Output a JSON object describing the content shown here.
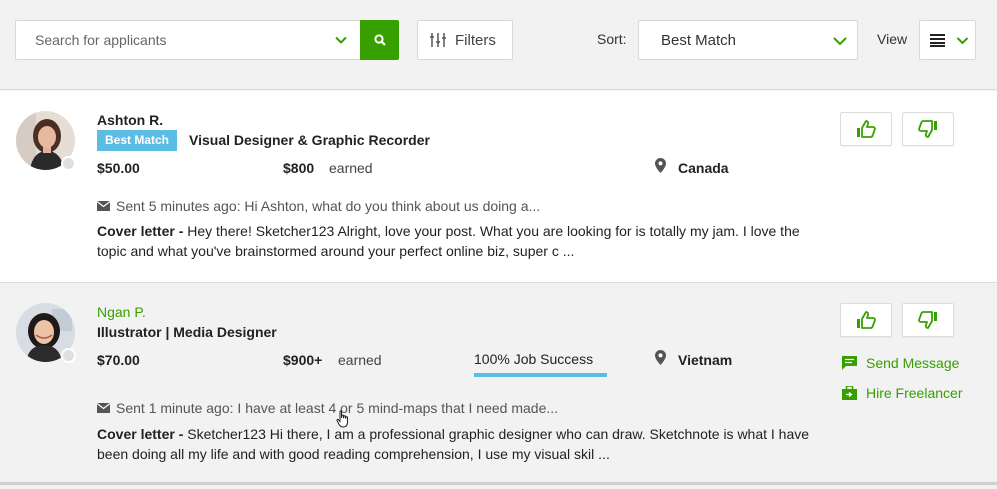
{
  "toolbar": {
    "search_placeholder": "Search for applicants",
    "filters_label": "Filters",
    "sort_label": "Sort:",
    "sort_value": "Best Match",
    "view_label": "View"
  },
  "applicants": [
    {
      "name": "Ashton R.",
      "badge": "Best Match",
      "title": "Visual Designer & Graphic Recorder",
      "rate": "$50.00",
      "earned_amount": "$800",
      "earned_label": "earned",
      "location": "Canada",
      "message": "Sent 5 minutes ago: Hi Ashton, what do you think about us doing a...",
      "cover_label": "Cover letter -",
      "cover_text": " Hey there! Sketcher123 Alright, love your post. What you are looking for is totally my jam. I love the topic and what you've brainstormed around your perfect online biz, super c ..."
    },
    {
      "name": "Ngan P.",
      "title": "Illustrator | Media Designer",
      "rate": "$70.00",
      "earned_amount": "$900+",
      "earned_label": "earned",
      "job_success": "100% Job Success",
      "location": "Vietnam",
      "message": "Sent 1 minute ago: I have at least 4 or 5 mind-maps that I need made...",
      "cover_label": "Cover letter -",
      "cover_text": " Sketcher123 Hi there, I am a professional graphic designer who can draw. Sketchnote is what I have been doing all my life and with good reading comprehension, I use my visual skil ...",
      "send_message_label": "Send Message",
      "hire_label": "Hire Freelancer"
    }
  ],
  "colors": {
    "brand_green": "#37a000",
    "badge_blue": "#5bbce4"
  },
  "icons": [
    "search-icon",
    "chevron-down-icon",
    "filters-icon",
    "list-view-icon",
    "map-pin-icon",
    "envelope-icon",
    "thumbs-up-icon",
    "thumbs-down-icon",
    "chat-icon",
    "briefcase-icon",
    "hand-cursor-icon"
  ]
}
